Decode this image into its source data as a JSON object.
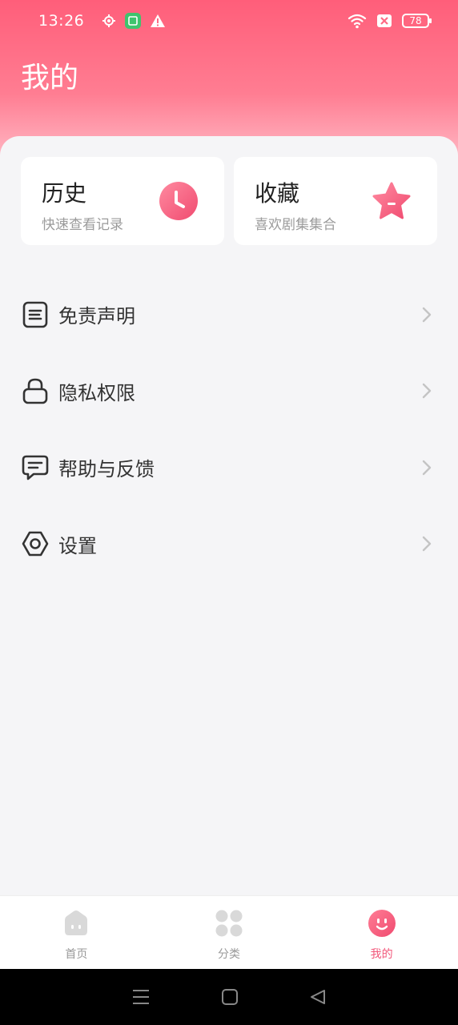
{
  "status_bar": {
    "time": "13:26",
    "battery": "78",
    "icons": [
      "location-icon",
      "notification-app-icon",
      "warning-icon",
      "wifi-icon",
      "sim-blocked-icon",
      "battery-icon"
    ]
  },
  "page": {
    "title": "我的"
  },
  "cards": {
    "history": {
      "title": "历史",
      "subtitle": "快速查看记录",
      "icon": "clock-icon"
    },
    "favorites": {
      "title": "收藏",
      "subtitle": "喜欢剧集集合",
      "icon": "star-icon"
    }
  },
  "menu": {
    "items": [
      {
        "label": "免责声明",
        "icon": "document-icon"
      },
      {
        "label": "隐私权限",
        "icon": "lock-icon"
      },
      {
        "label": "帮助与反馈",
        "icon": "message-icon"
      },
      {
        "label": "设置",
        "icon": "settings-icon"
      }
    ]
  },
  "bottom_nav": {
    "items": [
      {
        "label": "首页",
        "icon": "home-icon",
        "active": false
      },
      {
        "label": "分类",
        "icon": "category-icon",
        "active": false
      },
      {
        "label": "我的",
        "icon": "profile-icon",
        "active": true
      }
    ]
  },
  "colors": {
    "accent": "#f2577a",
    "header_top": "#ff5e7a",
    "inactive": "#d6d6d6"
  }
}
